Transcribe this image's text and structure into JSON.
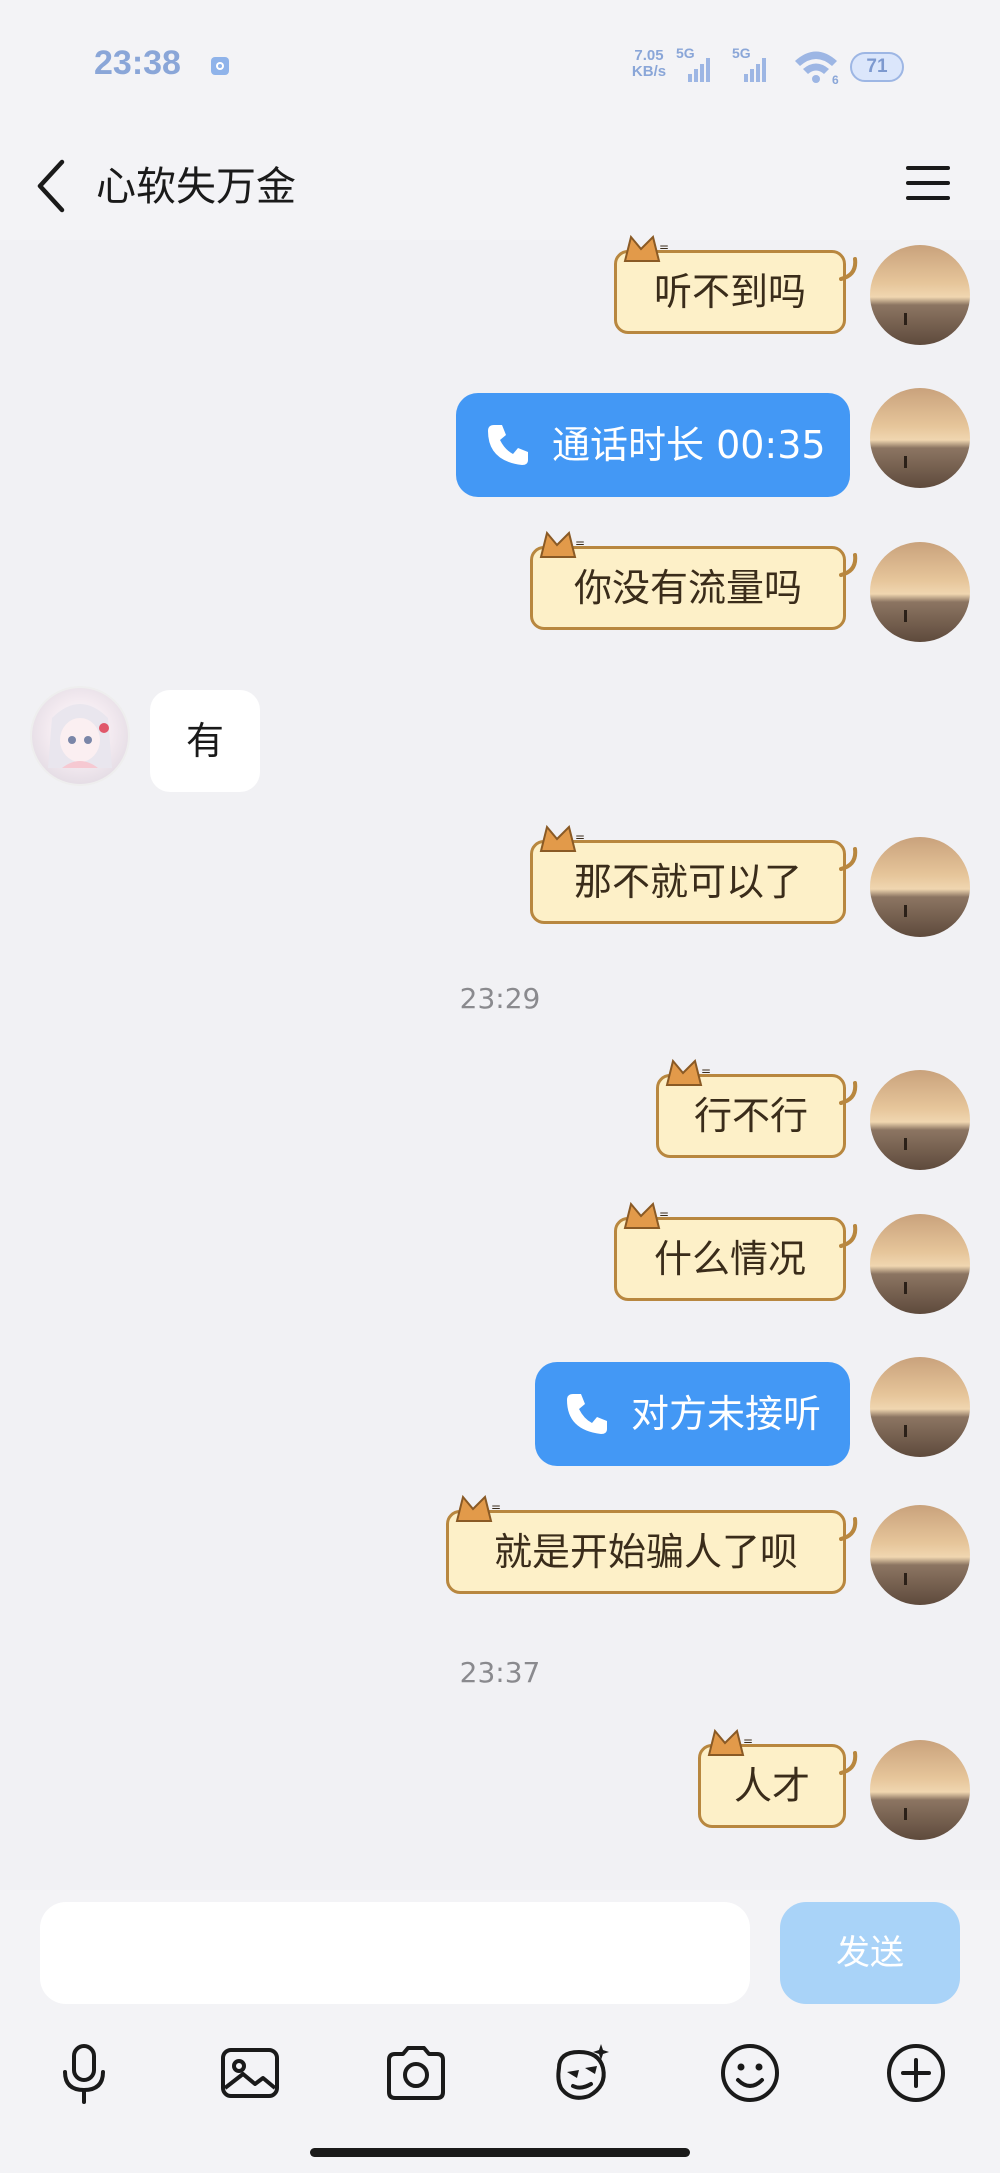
{
  "status_bar": {
    "time": "23:38",
    "net_speed_value": "7.05",
    "net_speed_unit": "KB/s",
    "signal1_label": "5G",
    "signal2_label": "5G",
    "wifi_badge": "6",
    "battery": "71",
    "colors": {
      "accent": "#8aa6d8"
    }
  },
  "header": {
    "title": "心软失万金"
  },
  "messages": [
    {
      "type": "text",
      "side": "self",
      "style": "cat",
      "text": "听不到吗"
    },
    {
      "type": "call",
      "side": "self",
      "text": "通话时长 00:35"
    },
    {
      "type": "text",
      "side": "self",
      "style": "cat",
      "text": "你没有流量吗"
    },
    {
      "type": "text",
      "side": "other",
      "style": "plain",
      "text": "有"
    },
    {
      "type": "text",
      "side": "self",
      "style": "cat",
      "text": "那不就可以了"
    },
    {
      "type": "timestamp",
      "text": "23:29"
    },
    {
      "type": "text",
      "side": "self",
      "style": "cat",
      "text": "行不行"
    },
    {
      "type": "text",
      "side": "self",
      "style": "cat",
      "text": "什么情况"
    },
    {
      "type": "call",
      "side": "self",
      "text": "对方未接听"
    },
    {
      "type": "text",
      "side": "self",
      "style": "cat",
      "text": "就是开始骗人了呗"
    },
    {
      "type": "timestamp",
      "text": "23:37"
    },
    {
      "type": "text",
      "side": "self",
      "style": "cat",
      "text": "人才"
    }
  ],
  "composer": {
    "input_value": "",
    "send_label": "发送"
  },
  "toolbar": [
    {
      "icon": "microphone-icon"
    },
    {
      "icon": "image-icon"
    },
    {
      "icon": "camera-icon"
    },
    {
      "icon": "sticker-icon"
    },
    {
      "icon": "emoji-icon"
    },
    {
      "icon": "plus-icon"
    }
  ],
  "colors": {
    "background": "#f1f1f4",
    "call_bubble": "#4398f5",
    "cat_bubble": "#fdf0c8",
    "send_button": "#a9d3f8"
  }
}
